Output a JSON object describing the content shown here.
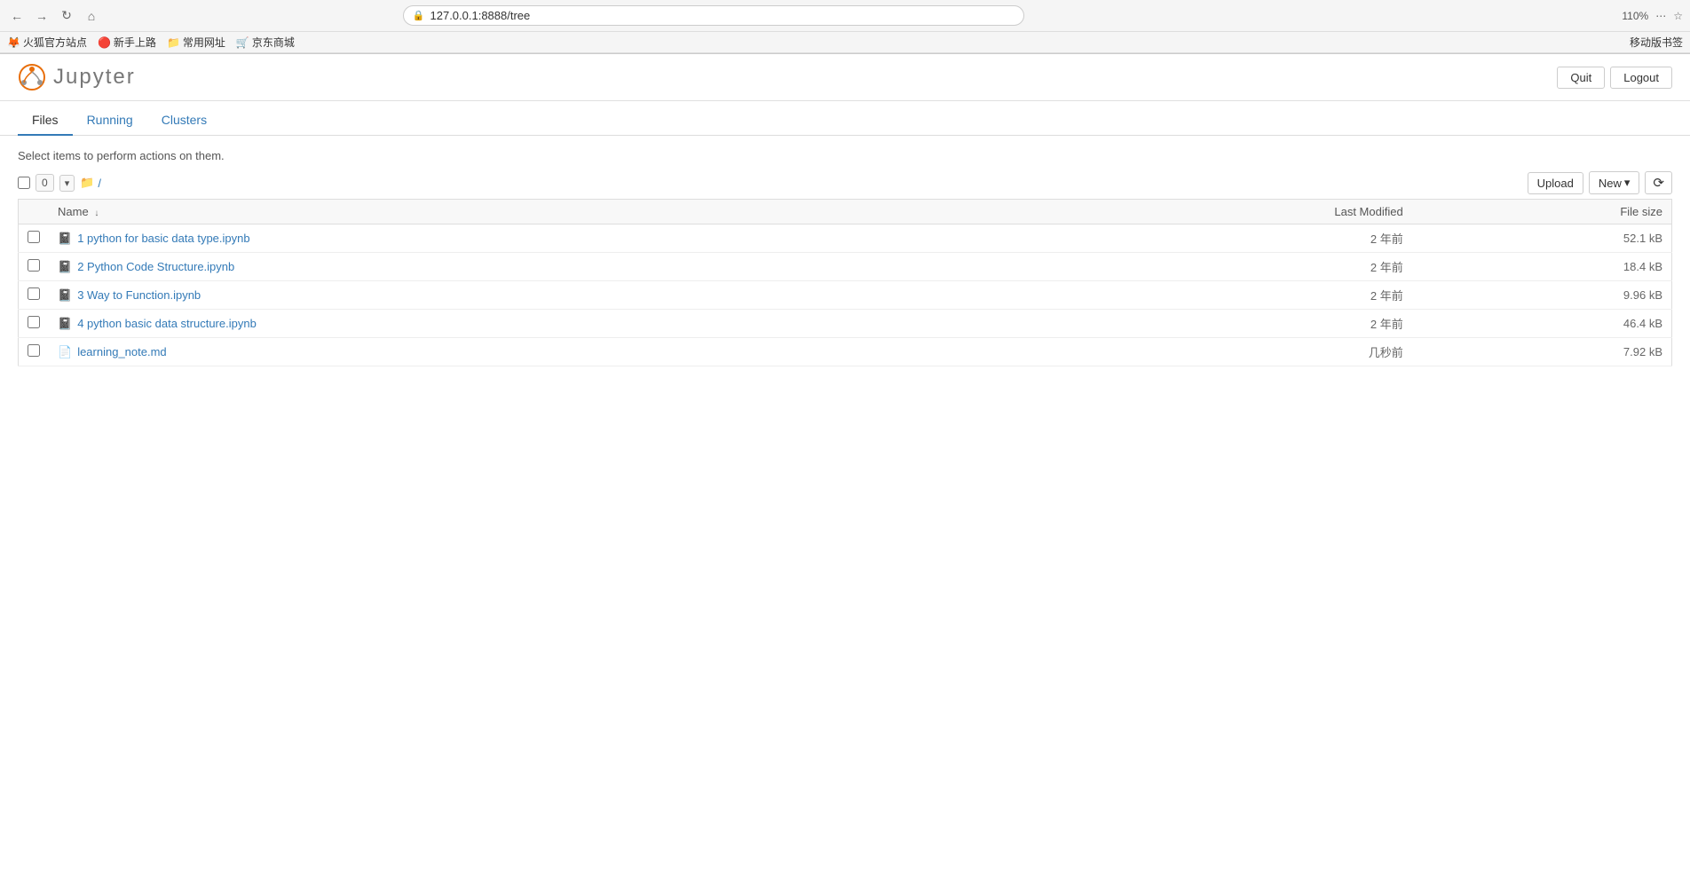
{
  "browser": {
    "address": "127.0.0.1:8888/tree",
    "zoom": "110%",
    "bookmarks": [
      {
        "label": "火狐官方站点",
        "icon": "🦊"
      },
      {
        "label": "新手上路",
        "icon": "🔴"
      },
      {
        "label": "常用网址",
        "icon": "📁"
      },
      {
        "label": "京东商城",
        "icon": "🛒"
      }
    ],
    "right_label": "移动版书签"
  },
  "header": {
    "logo_text": "Jupyter",
    "quit_label": "Quit",
    "logout_label": "Logout"
  },
  "tabs": [
    {
      "label": "Files",
      "active": true
    },
    {
      "label": "Running",
      "active": false
    },
    {
      "label": "Clusters",
      "active": false
    }
  ],
  "instructions": "Select items to perform actions on them.",
  "toolbar": {
    "count": "0",
    "breadcrumb": "/",
    "upload_label": "Upload",
    "new_label": "New",
    "new_arrow": "▾",
    "refresh_label": "⟳",
    "name_col": "Name",
    "name_sort": "↓",
    "last_modified_col": "Last Modified",
    "file_size_col": "File size"
  },
  "files": [
    {
      "name": "1 python for basic data type.ipynb",
      "type": "notebook",
      "icon": "📓",
      "last_modified": "2 年前",
      "file_size": "52.1 kB"
    },
    {
      "name": "2 Python Code Structure.ipynb",
      "type": "notebook",
      "icon": "📓",
      "last_modified": "2 年前",
      "file_size": "18.4 kB"
    },
    {
      "name": "3 Way to Function.ipynb",
      "type": "notebook",
      "icon": "📓",
      "last_modified": "2 年前",
      "file_size": "9.96 kB"
    },
    {
      "name": "4 python basic data structure.ipynb",
      "type": "notebook",
      "icon": "📓",
      "last_modified": "2 年前",
      "file_size": "46.4 kB"
    },
    {
      "name": "learning_note.md",
      "type": "markdown",
      "icon": "📄",
      "last_modified": "几秒前",
      "file_size": "7.92 kB"
    }
  ]
}
